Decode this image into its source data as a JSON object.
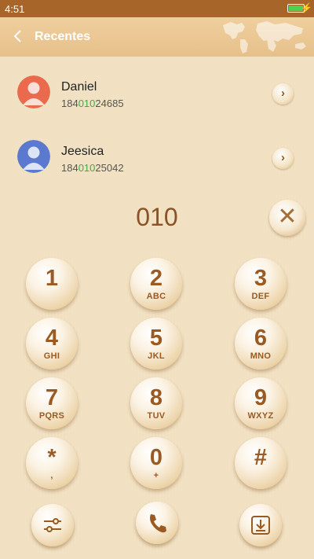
{
  "status_bar": {
    "time": "4:51"
  },
  "header": {
    "title": "Recentes"
  },
  "contacts": [
    {
      "name": "Daniel",
      "number_prefix": "184",
      "number_match": "010",
      "number_suffix": "24685",
      "avatar_color": "#ea6a4e"
    },
    {
      "name": "Jeesica",
      "number_prefix": "184",
      "number_match": "010",
      "number_suffix": "25042",
      "avatar_color": "#5a79cf"
    }
  ],
  "dialer": {
    "input": "010",
    "keys": [
      {
        "digit": "1",
        "letters": ""
      },
      {
        "digit": "2",
        "letters": "ABC"
      },
      {
        "digit": "3",
        "letters": "DEF"
      },
      {
        "digit": "4",
        "letters": "GHI"
      },
      {
        "digit": "5",
        "letters": "JKL"
      },
      {
        "digit": "6",
        "letters": "MNO"
      },
      {
        "digit": "7",
        "letters": "PQRS"
      },
      {
        "digit": "8",
        "letters": "TUV"
      },
      {
        "digit": "9",
        "letters": "WXYZ"
      },
      {
        "digit": "*",
        "letters": ","
      },
      {
        "digit": "0",
        "letters": "+"
      },
      {
        "digit": "#",
        "letters": ""
      }
    ]
  },
  "bottom_bar": {
    "icons": [
      "settings-sliders-icon",
      "phone-call-icon",
      "download-icon"
    ]
  },
  "colors": {
    "accent": "#9a5a22",
    "match": "#3dac48",
    "status_bar": "#a8652a",
    "battery": "#4cd34c"
  }
}
